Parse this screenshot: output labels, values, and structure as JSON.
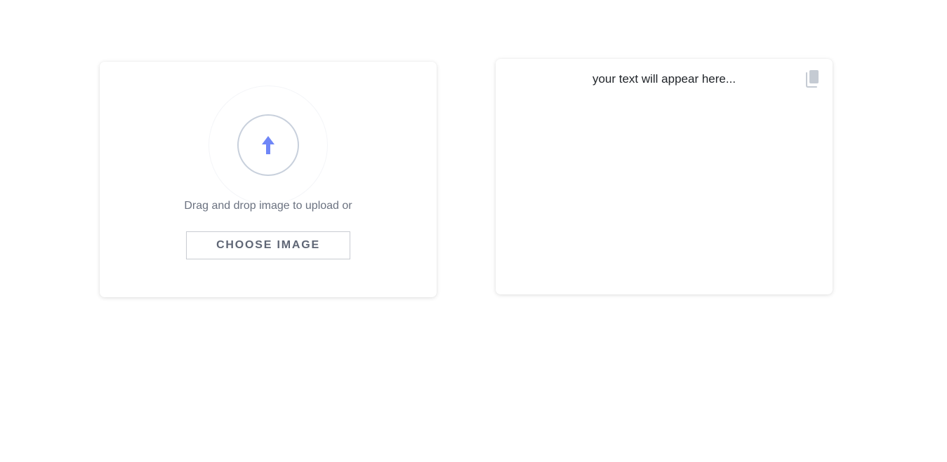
{
  "upload": {
    "instruction": "Drag and drop image to upload or",
    "choose_button_label": "CHOOSE IMAGE",
    "upload_icon": "arrow-up-icon",
    "accent_color": "#6f86f7"
  },
  "output": {
    "placeholder_text": "your text will appear here...",
    "copy_icon": "copy-icon",
    "icon_color": "#c5cbd3"
  }
}
